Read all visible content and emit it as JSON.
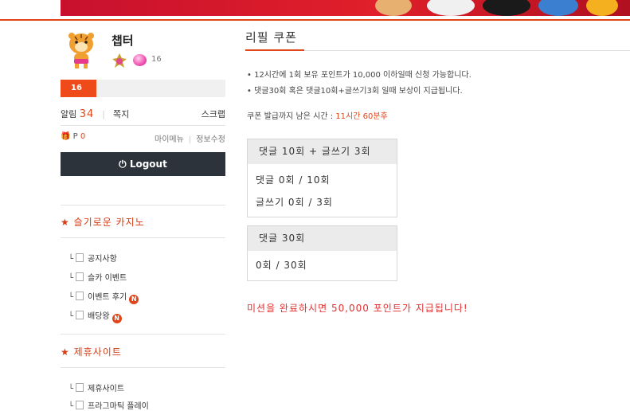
{
  "profile": {
    "nickname": "챕터",
    "item_count": "16",
    "level": "16",
    "alarm_label": "알림",
    "alarm_count": "34",
    "note_label": "쪽지",
    "scrap_label": "스크랩",
    "point_label": "P",
    "point_value": "0",
    "my_menu": "마이메뉴",
    "edit_info": "정보수정",
    "logout_label": "Logout"
  },
  "sidebar": {
    "section1": "★ 슬기로운 카지노",
    "section1_items": [
      {
        "label": "공지사항",
        "badge": ""
      },
      {
        "label": "슬카 이벤트",
        "badge": ""
      },
      {
        "label": "이벤트 후기",
        "badge": "N"
      },
      {
        "label": "배당왕",
        "badge": "N"
      }
    ],
    "section2": "★ 제휴사이트",
    "section2_items": [
      {
        "label": "제휴사이트",
        "badge": ""
      },
      {
        "label": "프라그마틱 플레이",
        "badge": ""
      }
    ]
  },
  "main": {
    "title": "리필 쿠폰",
    "notes": [
      "• 12시간에 1회 보유 포인트가 10,000 이하일때 신청 가능합니다.",
      "• 댓글30회 혹은 댓글10회+글쓰기3회 일때 보상이 지급됩니다."
    ],
    "remain_label": "쿠폰 발급까지 남은 시간 :",
    "remain_time": "11시간 60분후",
    "box1": {
      "header": "댓글 10회 + 글쓰기 3회",
      "line1": "댓글 0회 / 10회",
      "line2": "글쓰기 0회 / 3회"
    },
    "box2": {
      "header": "댓글 30회",
      "line1": "0회 / 30회"
    },
    "reward": "미션을 완료하시면 50,000 포인트가 지급됩니다!"
  },
  "colors": {
    "accent": "#e0461a",
    "logout_bg": "#2c333a",
    "reward": "#e03030"
  }
}
